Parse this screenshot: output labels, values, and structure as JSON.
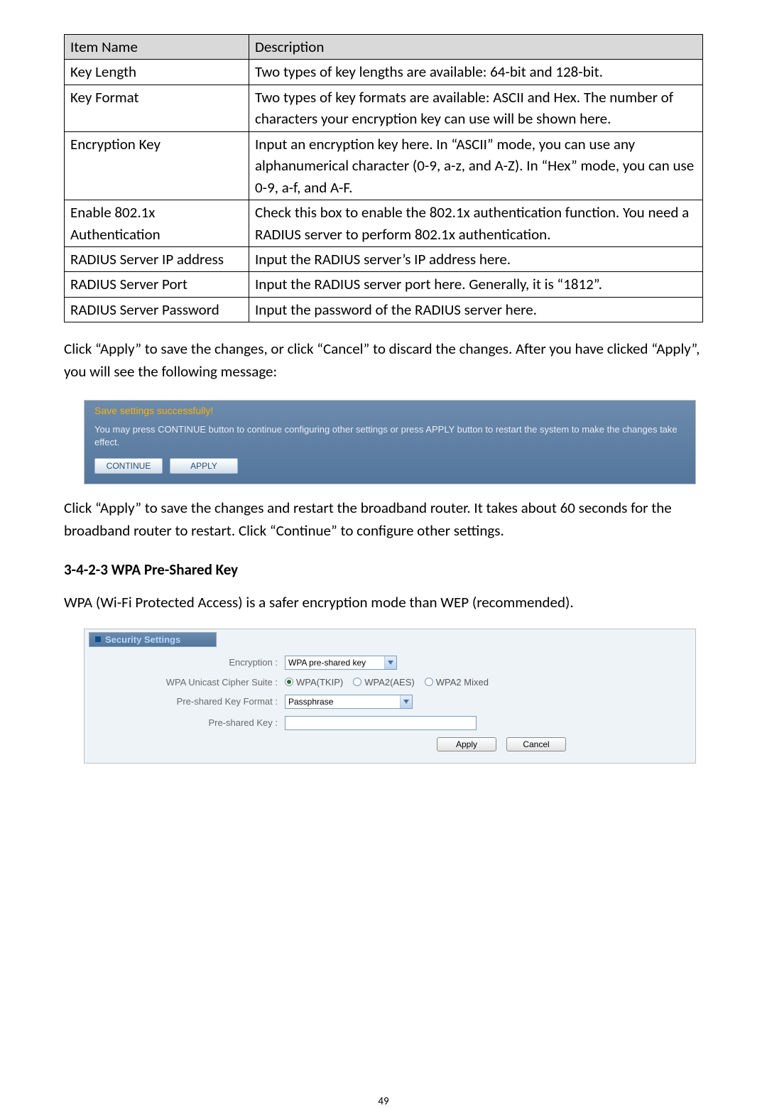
{
  "table": {
    "headers": [
      "Item Name",
      "Description"
    ],
    "rows": [
      {
        "name": "Key Length",
        "desc": "Two types of key lengths are available: 64-bit and 128-bit."
      },
      {
        "name": "Key Format",
        "desc": "Two types of key formats are available: ASCII and Hex. The number of characters your encryption key can use will be shown here."
      },
      {
        "name": "Encryption Key",
        "desc": "Input an encryption key here. In “ASCII” mode, you can use any alphanumerical character (0-9, a-z, and A-Z). In “Hex” mode, you can use 0-9, a-f, and A-F."
      },
      {
        "name": "Enable 802.1x Authentication",
        "desc": "Check this box to enable the 802.1x authentication function. You need a RADIUS server to perform 802.1x authentication."
      },
      {
        "name": "RADIUS Server IP address",
        "desc": "Input the RADIUS server’s IP address here."
      },
      {
        "name": "RADIUS Server Port",
        "desc": "Input the RADIUS server port here. Generally, it is “1812”."
      },
      {
        "name": "RADIUS Server Password",
        "desc": "Input the password of the RADIUS server here."
      }
    ]
  },
  "para1": "Click “Apply” to save the changes, or click “Cancel” to discard the changes. After you have clicked “Apply”, you will see the following message:",
  "savebox": {
    "title": "Save settings successfully!",
    "msg": "You may press CONTINUE button to continue configuring other settings or press APPLY button to restart the system to make the changes take effect.",
    "continue_label": "CONTINUE",
    "apply_label": "APPLY"
  },
  "para2": "Click “Apply” to save the changes and restart the broadband router. It takes about 60 seconds for the broadband router to restart. Click “Continue” to configure other settings.",
  "heading": "3-4-2-3 WPA Pre-Shared Key",
  "para3": "WPA (Wi-Fi Protected Access) is a safer encryption mode than WEP (recommended).",
  "security": {
    "panel_title": "Security Settings",
    "labels": {
      "encryption": "Encryption :",
      "cipher": "WPA Unicast Cipher Suite :",
      "preshared_format": "Pre-shared Key Format :",
      "preshared_key": "Pre-shared Key :"
    },
    "encryption_value": "WPA pre-shared key",
    "cipher_options": {
      "wpa_tkip": "WPA(TKIP)",
      "wpa2_aes": "WPA2(AES)",
      "wpa2_mixed": "WPA2 Mixed"
    },
    "preshared_format_value": "Passphrase",
    "apply_label": "Apply",
    "cancel_label": "Cancel"
  },
  "page_number": "49"
}
